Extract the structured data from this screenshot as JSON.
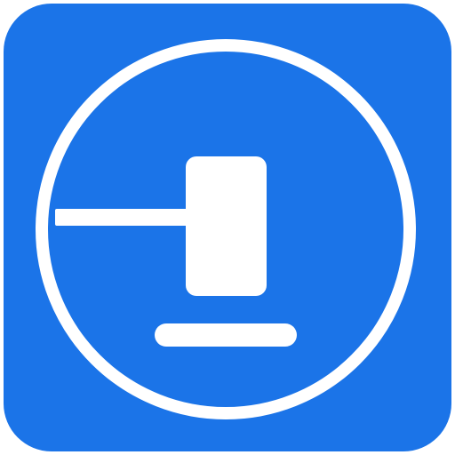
{
  "icon": {
    "name": "auction-gavel-icon",
    "background_color": "#1B74E8",
    "foreground_color": "#FFFFFF",
    "symbol_parts": [
      "gavel-head-icon",
      "gavel-handle-icon",
      "gavel-base-icon",
      "circle-outline"
    ]
  }
}
